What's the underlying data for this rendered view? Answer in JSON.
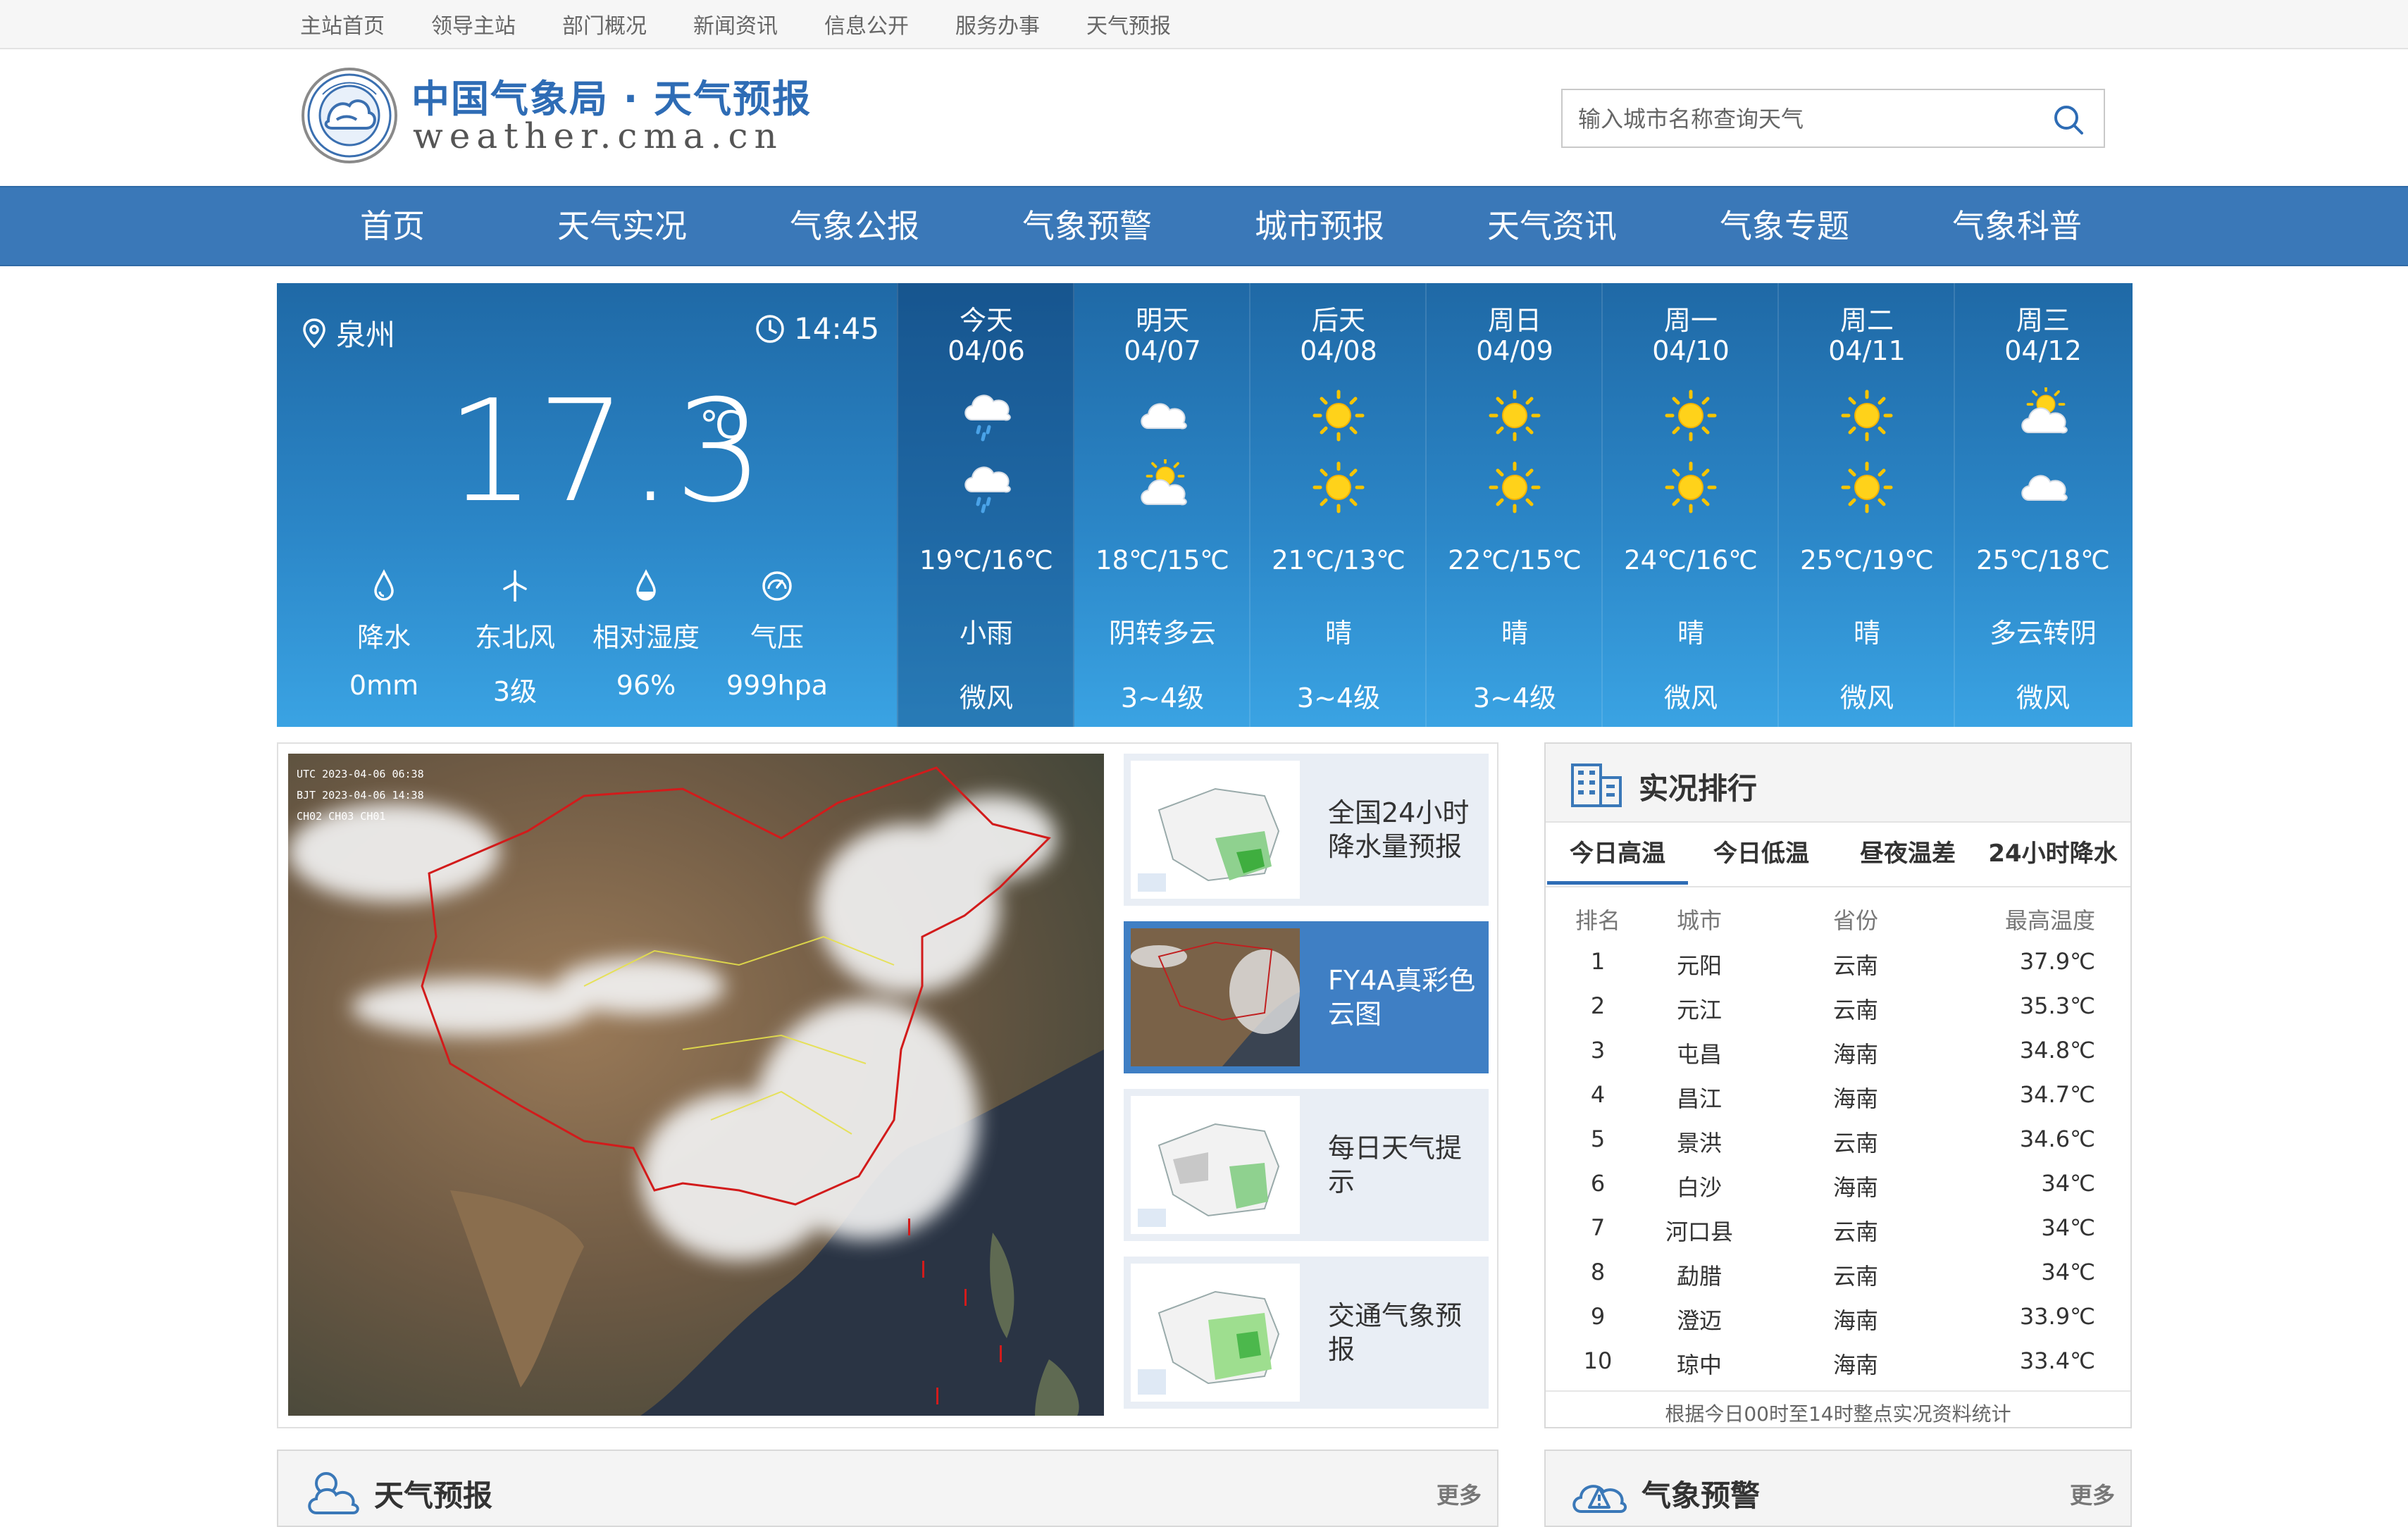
{
  "toplinks": [
    "主站首页",
    "领导主站",
    "部门概况",
    "新闻资讯",
    "信息公开",
    "服务办事",
    "天气预报"
  ],
  "logo": {
    "title": "中国气象局 · 天气预报",
    "url": "weather.cma.cn"
  },
  "search": {
    "placeholder": "输入城市名称查询天气"
  },
  "nav": [
    "首页",
    "天气实况",
    "气象公报",
    "气象预警",
    "城市预报",
    "天气资讯",
    "气象专题",
    "气象科普"
  ],
  "current": {
    "city": "泉州",
    "time": "14:45",
    "temp": "17.3",
    "unit": "℃",
    "stats": [
      {
        "icon": "raindrop-icon",
        "label": "降水",
        "value": "0mm"
      },
      {
        "icon": "wind-turbine-icon",
        "label": "东北风",
        "value": "3级"
      },
      {
        "icon": "humidity-icon",
        "label": "相对湿度",
        "value": "96%"
      },
      {
        "icon": "pressure-gauge-icon",
        "label": "气压",
        "value": "999hpa"
      }
    ]
  },
  "forecast": [
    {
      "day": "今天",
      "date": "04/06",
      "icon_day": "light-rain-icon",
      "icon_night": "light-rain-icon",
      "temp": "19℃/16℃",
      "cond": "小雨",
      "wind": "微风"
    },
    {
      "day": "明天",
      "date": "04/07",
      "icon_day": "cloudy-icon",
      "icon_night": "partly-cloudy-icon",
      "temp": "18℃/15℃",
      "cond": "阴转多云",
      "wind": "3~4级"
    },
    {
      "day": "后天",
      "date": "04/08",
      "icon_day": "sun-icon",
      "icon_night": "sun-icon",
      "temp": "21℃/13℃",
      "cond": "晴",
      "wind": "3~4级"
    },
    {
      "day": "周日",
      "date": "04/09",
      "icon_day": "sun-icon",
      "icon_night": "sun-icon",
      "temp": "22℃/15℃",
      "cond": "晴",
      "wind": "3~4级"
    },
    {
      "day": "周一",
      "date": "04/10",
      "icon_day": "sun-icon",
      "icon_night": "sun-icon",
      "temp": "24℃/16℃",
      "cond": "晴",
      "wind": "微风"
    },
    {
      "day": "周二",
      "date": "04/11",
      "icon_day": "sun-icon",
      "icon_night": "sun-icon",
      "temp": "25℃/19℃",
      "cond": "晴",
      "wind": "微风"
    },
    {
      "day": "周三",
      "date": "04/12",
      "icon_day": "partly-cloudy-icon",
      "icon_night": "cloudy-icon",
      "temp": "25℃/18℃",
      "cond": "多云转阴",
      "wind": "微风"
    }
  ],
  "satellite": {
    "overlay": [
      "UTC 2023-04-06 06:38",
      "BJT 2023-04-06 14:38",
      "CH02 CH03 CH01"
    ]
  },
  "thumbs": [
    {
      "label": "全国24小时降水量预报",
      "active": false
    },
    {
      "label": "FY4A真彩色云图",
      "active": true
    },
    {
      "label": "每日天气提示",
      "active": false
    },
    {
      "label": "交通气象预报",
      "active": false
    }
  ],
  "ranking": {
    "title": "实况排行",
    "tabs": [
      "今日高温",
      "今日低温",
      "昼夜温差",
      "24小时降水"
    ],
    "headers": [
      "排名",
      "城市",
      "省份",
      "最高温度"
    ],
    "rows": [
      [
        "1",
        "元阳",
        "云南",
        "37.9℃"
      ],
      [
        "2",
        "元江",
        "云南",
        "35.3℃"
      ],
      [
        "3",
        "屯昌",
        "海南",
        "34.8℃"
      ],
      [
        "4",
        "昌江",
        "海南",
        "34.7℃"
      ],
      [
        "5",
        "景洪",
        "云南",
        "34.6℃"
      ],
      [
        "6",
        "白沙",
        "海南",
        "34℃"
      ],
      [
        "7",
        "河口县",
        "云南",
        "34℃"
      ],
      [
        "8",
        "勐腊",
        "云南",
        "34℃"
      ],
      [
        "9",
        "澄迈",
        "海南",
        "33.9℃"
      ],
      [
        "10",
        "琼中",
        "海南",
        "33.4℃"
      ]
    ],
    "footnote": "根据今日00时至14时整点实况资料统计"
  },
  "bottom": [
    {
      "title": "天气预报",
      "more": "更多"
    },
    {
      "title": "气象预警",
      "more": "更多"
    }
  ],
  "colors": {
    "nav": "#3a78b8",
    "brand": "#2e6cb5",
    "panel_top": "#1f69a6",
    "panel_bottom": "#3aa3e3",
    "active_thumb": "#3f7fc4"
  }
}
